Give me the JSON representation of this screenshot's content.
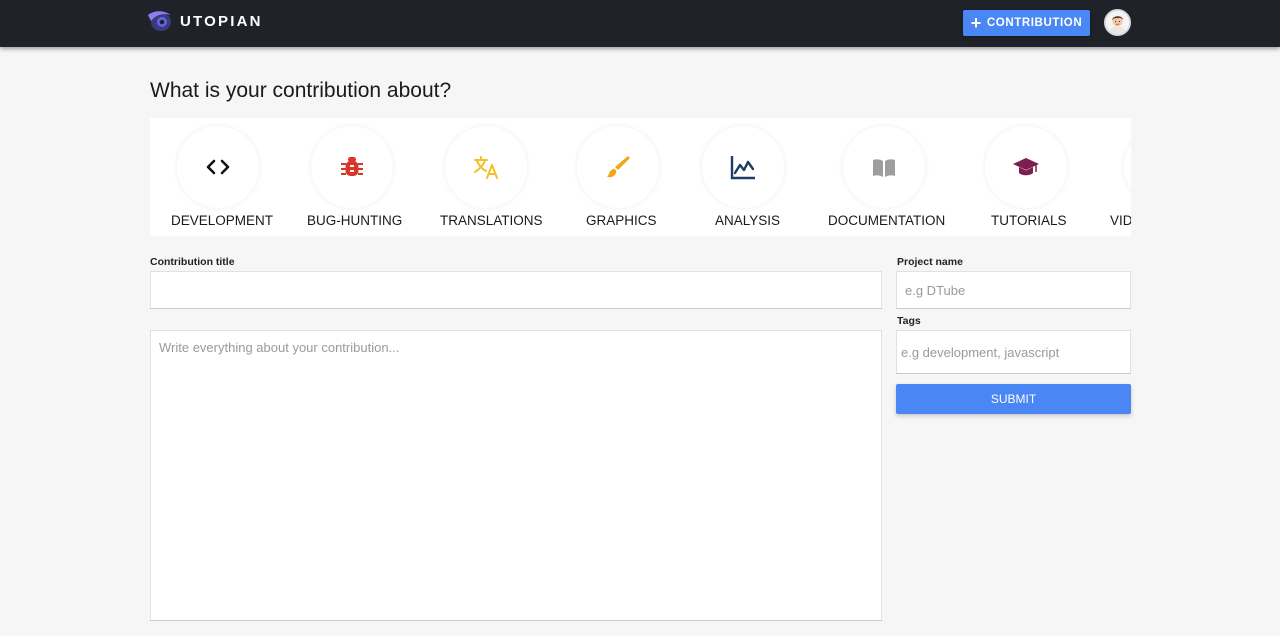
{
  "header": {
    "logo_text": "UTOPIAN",
    "contribution_button": "CONTRIBUTION",
    "colors": {
      "bar": "#1f2228",
      "accent": "#4a87f4"
    }
  },
  "page": {
    "heading": "What is your contribution about?"
  },
  "categories": [
    {
      "label": "DEVELOPMENT",
      "icon": "code-icon",
      "color": "#111111"
    },
    {
      "label": "BUG-HUNTING",
      "icon": "bug-icon",
      "color": "#d9352b"
    },
    {
      "label": "TRANSLATIONS",
      "icon": "translate-icon",
      "color": "#f5bf26"
    },
    {
      "label": "GRAPHICS",
      "icon": "brush-icon",
      "color": "#f2a51a"
    },
    {
      "label": "ANALYSIS",
      "icon": "line-chart-icon",
      "color": "#1b3c66"
    },
    {
      "label": "DOCUMENTATION",
      "icon": "book-icon",
      "color": "#9e9e9e"
    },
    {
      "label": "TUTORIALS",
      "icon": "graduation-cap-icon",
      "color": "#7a1f4f"
    },
    {
      "label": "VID",
      "icon": "video-icon",
      "color": "#999999"
    }
  ],
  "form": {
    "title_label": "Contribution title",
    "title_value": "",
    "body_placeholder": "Write everything about your contribution...",
    "project_label": "Project name",
    "project_placeholder": "e.g DTube",
    "tags_label": "Tags",
    "tags_placeholder": "e.g development, javascript",
    "submit_label": "SUBMIT"
  }
}
